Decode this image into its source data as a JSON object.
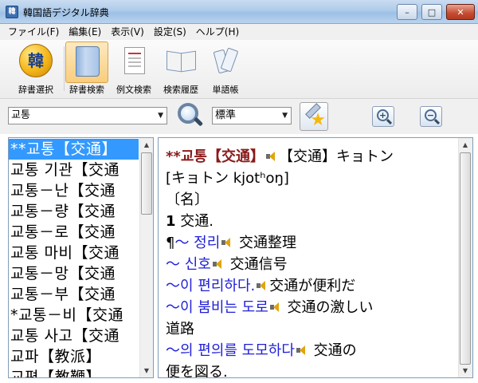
{
  "window": {
    "title": "韓国語デジタル辞典",
    "icon": "app-icon",
    "min": "–",
    "max": "□",
    "close": "✕"
  },
  "menu": [
    "ファイル(F)",
    "編集(E)",
    "表示(V)",
    "設定(S)",
    "ヘルプ(H)"
  ],
  "toolbar": {
    "items": [
      {
        "label": "辞書選択",
        "icon": "dictionary-select-icon",
        "active": false
      },
      {
        "label": "辞書検索",
        "icon": "book-icon",
        "active": true
      },
      {
        "label": "例文検索",
        "icon": "document-icon",
        "active": false
      },
      {
        "label": "検索履歴",
        "icon": "open-book-icon",
        "active": false
      },
      {
        "label": "単語帳",
        "icon": "word-cards-icon",
        "active": false
      }
    ],
    "globe_char": "韓"
  },
  "search": {
    "query": "교통",
    "mode": "標準",
    "zoom_in": "+",
    "zoom_out": "−"
  },
  "word_list": [
    "**교통【交通】",
    "교통 기관【交通",
    "교통－난【交通",
    "교통－량【交通",
    "교통－로【交通",
    "교통 마비【交通",
    "교통－망【交通",
    "교통－부【交通",
    "*교통－비【交通",
    "교통 사고【交通",
    "교파【教派】",
    "교편【教鞭】"
  ],
  "word_list_selected": 0,
  "entry": {
    "headword": "**교통【交通】",
    "reading": "【交通】キョトン",
    "pronunciation": "[キョトン kjotʰoŋ]",
    "pos": "〔名〕",
    "sense_num": "1",
    "sense_text": " 交通.",
    "examples": [
      {
        "prefix": "¶",
        "ko": "～ 정리",
        "ja": " 交通整理"
      },
      {
        "prefix": "",
        "ko": "～ 신호",
        "ja": " 交通信号"
      },
      {
        "prefix": "",
        "ko": "～이 편리하다.",
        "ja": "交通が便利だ"
      },
      {
        "prefix": "",
        "ko": "～이 붐비는 도로",
        "ja": " 交通の激しい"
      },
      {
        "prefix": "",
        "ko": "",
        "ja": "道路"
      },
      {
        "prefix": "",
        "ko": "～의 편의를 도모하다",
        "ja": " 交通の"
      },
      {
        "prefix": "",
        "ko": "",
        "ja": "便を図る."
      }
    ]
  }
}
